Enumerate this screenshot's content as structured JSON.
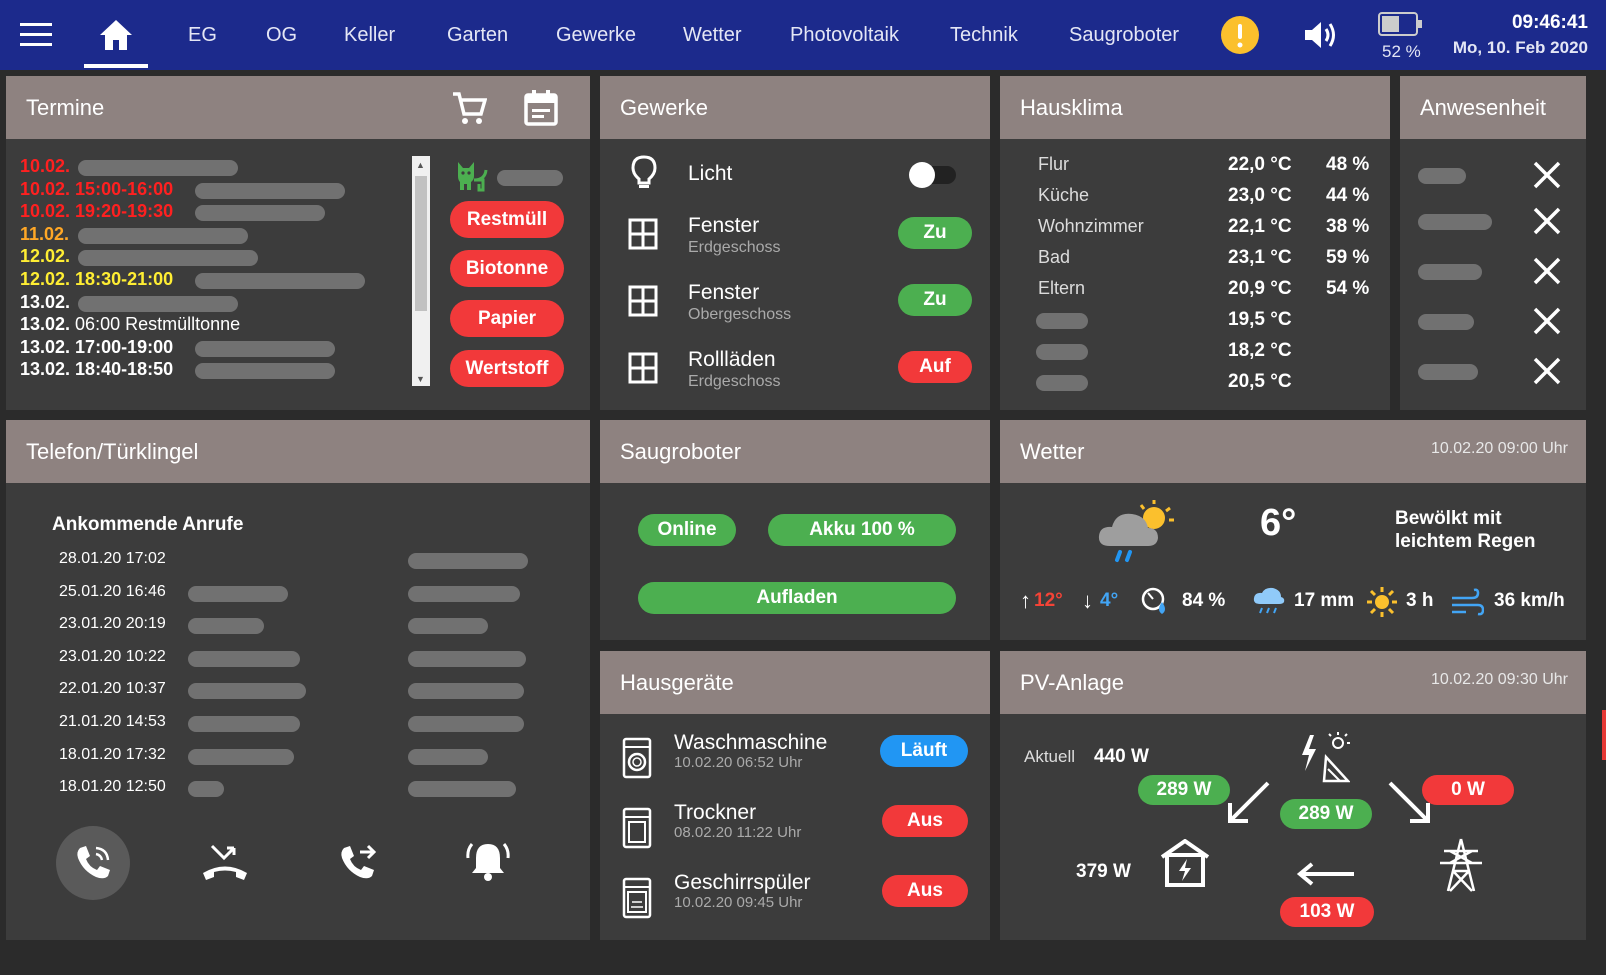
{
  "topbar": {
    "tabs": [
      "EG",
      "OG",
      "Keller",
      "Garten",
      "Gewerke",
      "Wetter",
      "Photovoltaik",
      "Technik",
      "Saugroboter"
    ],
    "battery": "52 %",
    "time": "09:46:41",
    "date": "Mo, 10. Feb 2020",
    "battery_level": 0.52
  },
  "termine": {
    "title": "Termine",
    "items": [
      {
        "date": "10.02.",
        "time": "",
        "color": "#ff2020"
      },
      {
        "date": "10.02.",
        "time": "15:00-16:00",
        "color": "#ff2020"
      },
      {
        "date": "10.02.",
        "time": "19:20-19:30",
        "color": "#ff2020"
      },
      {
        "date": "11.02.",
        "time": "",
        "color": "#ffa726"
      },
      {
        "date": "12.02.",
        "time": "",
        "color": "#ffee33"
      },
      {
        "date": "12.02.",
        "time": "18:30-21:00",
        "color": "#ffee33"
      },
      {
        "date": "13.02.",
        "time": "",
        "color": "#ffffff"
      },
      {
        "date": "13.02.",
        "time": "06:00 Restmülltonne",
        "color": "#ffffff"
      },
      {
        "date": "13.02.",
        "time": "17:00-19:00",
        "color": "#ffffff"
      },
      {
        "date": "13.02.",
        "time": "18:40-18:50",
        "color": "#ffffff"
      }
    ],
    "waste": [
      "Restmüll",
      "Biotonne",
      "Papier",
      "Wertstoff"
    ]
  },
  "gewerke": {
    "title": "Gewerke",
    "licht": "Licht",
    "rows": [
      {
        "label": "Fenster",
        "sub": "Erdgeschoss",
        "state": "Zu"
      },
      {
        "label": "Fenster",
        "sub": "Obergeschoss",
        "state": "Zu"
      },
      {
        "label": "Rollläden",
        "sub": "Erdgeschoss",
        "state": "Auf"
      }
    ]
  },
  "hausklima": {
    "title": "Hausklima",
    "rows": [
      {
        "room": "Flur",
        "temp": "22,0 °C",
        "hum": "48 %"
      },
      {
        "room": "Küche",
        "temp": "23,0 °C",
        "hum": "44 %"
      },
      {
        "room": "Wohnzimmer",
        "temp": "22,1 °C",
        "hum": "38 %"
      },
      {
        "room": "Bad",
        "temp": "23,1 °C",
        "hum": "59 %"
      },
      {
        "room": "Eltern",
        "temp": "20,9 °C",
        "hum": "54 %"
      },
      {
        "room": "",
        "temp": "19,5 °C",
        "hum": ""
      },
      {
        "room": "",
        "temp": "18,2 °C",
        "hum": ""
      },
      {
        "room": "",
        "temp": "20,5 °C",
        "hum": ""
      }
    ]
  },
  "anwesenheit": {
    "title": "Anwesenheit"
  },
  "telefon": {
    "title": "Telefon/Türklingel",
    "heading": "Ankommende Anrufe",
    "calls": [
      "28.01.20 17:02",
      "25.01.20 16:46",
      "23.01.20 20:19",
      "23.01.20 10:22",
      "22.01.20 10:37",
      "21.01.20 14:53",
      "18.01.20 17:32",
      "18.01.20 12:50"
    ]
  },
  "saugroboter": {
    "title": "Saugroboter",
    "online": "Online",
    "akku": "Akku 100 %",
    "aufladen": "Aufladen"
  },
  "wetter": {
    "title": "Wetter",
    "timestamp": "10.02.20 09:00 Uhr",
    "temp": "6°",
    "desc1": "Bewölkt mit",
    "desc2": "leichtem Regen",
    "max": "12°",
    "min": "4°",
    "humidity": "84 %",
    "rain": "17 mm",
    "sun": "3 h",
    "wind": "36 km/h"
  },
  "hausgeraete": {
    "title": "Hausgeräte",
    "rows": [
      {
        "name": "Waschmaschine",
        "time": "10.02.20 06:52 Uhr",
        "state": "Läuft"
      },
      {
        "name": "Trockner",
        "time": "08.02.20 11:22 Uhr",
        "state": "Aus"
      },
      {
        "name": "Geschirrspüler",
        "time": "10.02.20 09:45 Uhr",
        "state": "Aus"
      }
    ]
  },
  "pv": {
    "title": "PV-Anlage",
    "timestamp": "10.02.20 09:30 Uhr",
    "aktuell_label": "Aktuell",
    "aktuell": "440 W",
    "to_house": "289 W",
    "solar": "289 W",
    "grid": "0 W",
    "house": "379 W",
    "from_grid": "103 W"
  }
}
